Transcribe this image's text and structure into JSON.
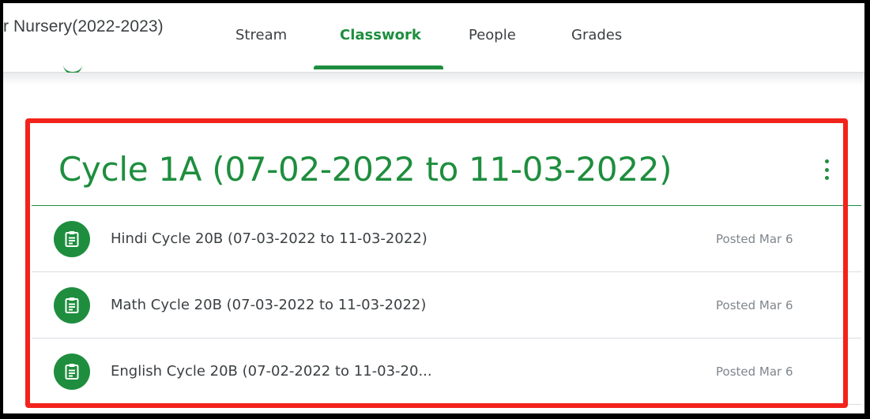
{
  "header": {
    "class_title": "r Nursery(2022-2023)",
    "tabs": [
      {
        "label": "Stream"
      },
      {
        "label": "Classwork"
      },
      {
        "label": "People"
      },
      {
        "label": "Grades"
      }
    ],
    "active_tab": "Classwork"
  },
  "topic": {
    "title": "Cycle 1A (07-02-2022 to 11-03-2022)",
    "menu_icon": "more-vert-icon"
  },
  "assignments": [
    {
      "title": "Hindi Cycle 20B (07-03-2022 to 11-03-2022)",
      "posted": "Posted Mar 6",
      "icon": "assignment-icon"
    },
    {
      "title": "Math Cycle 20B (07-03-2022 to 11-03-2022)",
      "posted": "Posted Mar 6",
      "icon": "assignment-icon"
    },
    {
      "title": "English Cycle 20B (07-02-2022 to 11-03-20...",
      "posted": "Posted Mar 6",
      "icon": "assignment-icon"
    }
  ],
  "colors": {
    "accent": "#1e8e3e",
    "highlight": "#f2231b"
  }
}
